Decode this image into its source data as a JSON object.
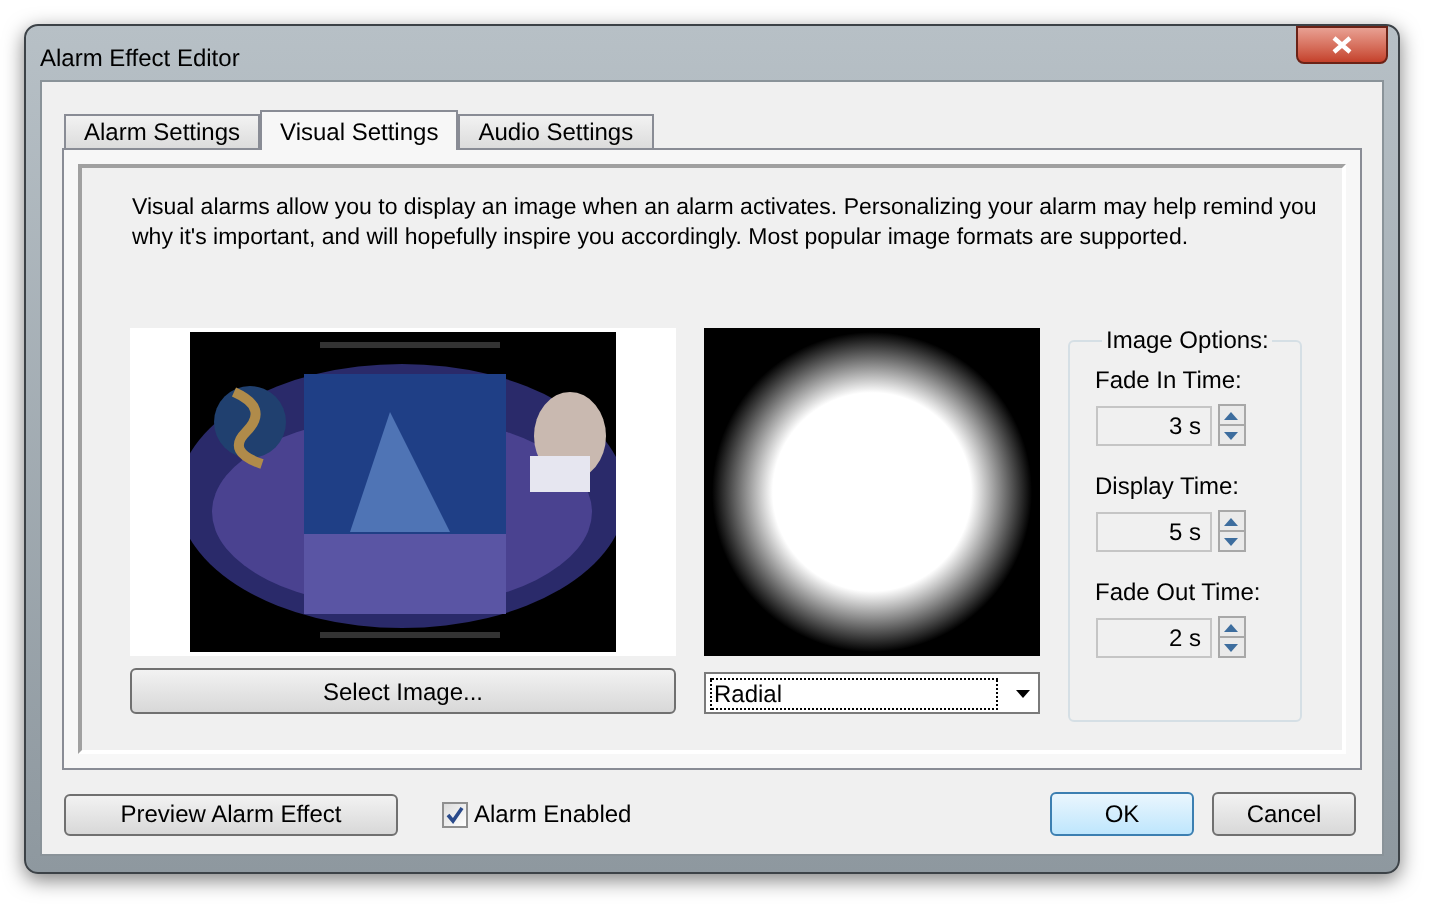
{
  "window": {
    "title": "Alarm Effect Editor"
  },
  "tabs": [
    {
      "label": "Alarm Settings",
      "selected": false
    },
    {
      "label": "Visual Settings",
      "selected": true
    },
    {
      "label": "Audio Settings",
      "selected": false
    }
  ],
  "description": "Visual alarms allow you to display an image when an alarm activates.  Personalizing your alarm may help remind you why it's important, and will hopefully inspire you accordingly.  Most popular image formats are supported.",
  "select_image_button": "Select Image...",
  "effect_dropdown": {
    "value": "Radial"
  },
  "image_options": {
    "title": "Image Options:",
    "fields": [
      {
        "label": "Fade In Time:",
        "value": "3 s"
      },
      {
        "label": "Display Time:",
        "value": "5 s"
      },
      {
        "label": "Fade Out Time:",
        "value": "2 s"
      }
    ]
  },
  "preview_button": "Preview Alarm Effect",
  "alarm_enabled": {
    "label": "Alarm Enabled",
    "checked": true
  },
  "buttons": [
    {
      "label": "OK",
      "default": true
    },
    {
      "label": "Cancel",
      "default": false
    }
  ]
}
